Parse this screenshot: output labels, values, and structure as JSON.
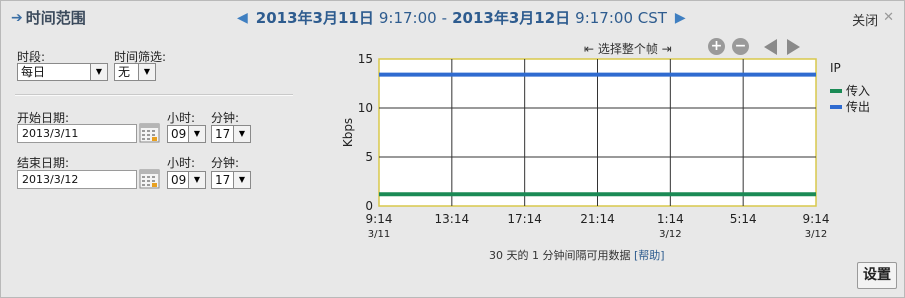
{
  "header": {
    "title": "时间范围",
    "range_start_date": "2013年3月11日",
    "range_start_time": "9:17:00",
    "range_sep": "-",
    "range_end_date": "2013年3月12日",
    "range_end_time": "9:17:00 CST",
    "close_label": "关闭"
  },
  "form": {
    "period_label": "时段:",
    "period_value": "每日",
    "time_filter_label": "时间筛选:",
    "time_filter_value": "无",
    "start_date_label": "开始日期:",
    "start_date_value": "2013/3/11",
    "start_hour_label": "小时:",
    "start_hour_value": "09",
    "start_minute_label": "分钟:",
    "start_minute_value": "17",
    "end_date_label": "结束日期:",
    "end_date_value": "2013/3/12",
    "end_hour_label": "小时:",
    "end_hour_value": "09",
    "end_minute_label": "分钟:",
    "end_minute_value": "17"
  },
  "chart_controls": {
    "select_whole_label": "⇤ 选择整个帧 ⇥"
  },
  "chart_data": {
    "type": "line",
    "ylabel": "Kbps",
    "ylim": [
      0,
      15
    ],
    "yticks": [
      "0",
      "5",
      "10",
      "15"
    ],
    "x_ticks": [
      {
        "label": "9:14",
        "sub": "3/11"
      },
      {
        "label": "13:14",
        "sub": ""
      },
      {
        "label": "17:14",
        "sub": ""
      },
      {
        "label": "21:14",
        "sub": ""
      },
      {
        "label": "1:14",
        "sub": "3/12"
      },
      {
        "label": "5:14",
        "sub": ""
      },
      {
        "label": "9:14",
        "sub": "3/12"
      }
    ],
    "legend_title": "IP",
    "series": [
      {
        "name": "传入",
        "color": "#1a8a55",
        "value": 1.2
      },
      {
        "name": "传出",
        "color": "#2f6bd0",
        "value": 13.4
      }
    ]
  },
  "footnote": {
    "text": "30 天的 1 分钟间隔可用数据",
    "link": "[帮助]"
  },
  "settings_label": "设置"
}
